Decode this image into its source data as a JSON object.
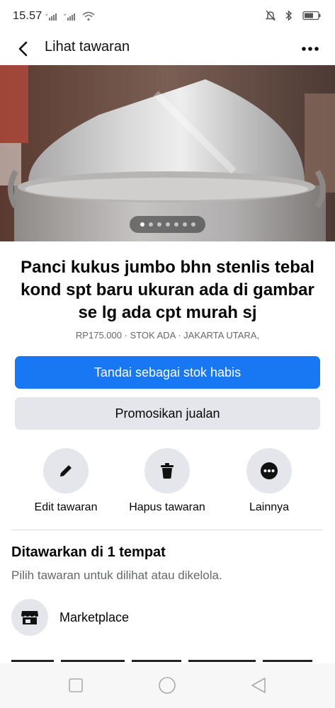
{
  "status_bar": {
    "time": "15.57"
  },
  "header": {
    "title": "Lihat tawaran"
  },
  "photo": {
    "dot_count": 7,
    "active_dot": 0
  },
  "listing": {
    "title": "Panci kukus jumbo bhn stenlis tebal kond spt baru ukuran ada di gambar se lg ada cpt murah sj",
    "meta": "RP175.000 · STOK ADA · JAKARTA UTARA,"
  },
  "buttons": {
    "mark_sold": "Tandai sebagai stok habis",
    "promote": "Promosikan jualan"
  },
  "actions": [
    {
      "label": "Edit tawaran",
      "icon": "pencil-icon"
    },
    {
      "label": "Hapus tawaran",
      "icon": "trash-icon"
    },
    {
      "label": "Lainnya",
      "icon": "more-icon"
    }
  ],
  "section": {
    "title": "Ditawarkan di 1 tempat",
    "subtitle": "Pilih tawaran untuk dilihat atau dikelola.",
    "items": [
      {
        "label": "Marketplace",
        "icon": "shop-icon"
      }
    ]
  },
  "colors": {
    "primary": "#1877f2",
    "secondary_bg": "#e4e6eb",
    "muted_text": "#65676b"
  }
}
